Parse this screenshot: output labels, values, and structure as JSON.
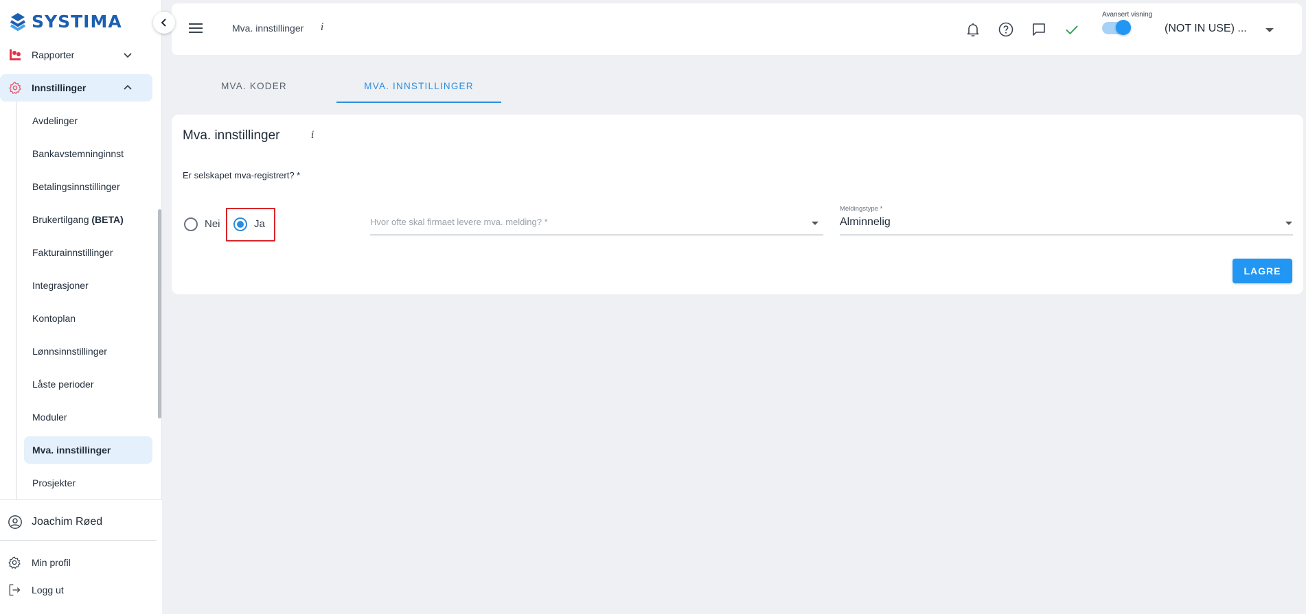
{
  "app": {
    "logo_text": "SYSTIMA",
    "brand_color": "#1d5fb0",
    "accent_color": "#2a8ee0"
  },
  "sidebar": {
    "items": [
      {
        "label": "Rapporter",
        "icon": "chart-icon",
        "expanded": false
      },
      {
        "label": "Innstillinger",
        "icon": "settings-icon",
        "expanded": true
      }
    ],
    "sub_items": [
      {
        "label": "Avdelinger"
      },
      {
        "label": "Bankavstemninginnst"
      },
      {
        "label": "Betalingsinnstillinger"
      },
      {
        "label": "Brukertilgang",
        "suffix": "(BETA)"
      },
      {
        "label": "Fakturainnstillinger"
      },
      {
        "label": "Integrasjoner"
      },
      {
        "label": "Kontoplan"
      },
      {
        "label": "Lønnsinnstillinger"
      },
      {
        "label": "Låste perioder"
      },
      {
        "label": "Moduler"
      },
      {
        "label": "Mva. innstillinger",
        "active": true
      },
      {
        "label": "Prosjekter"
      }
    ],
    "user_name": "Joachim Røed",
    "profile_label": "Min profil",
    "logout_label": "Logg ut"
  },
  "topbar": {
    "breadcrumb": "Mva. innstillinger",
    "info_glyph": "i",
    "advanced_label": "Avansert visning",
    "advanced_on": true,
    "company": "(NOT IN USE) ..."
  },
  "tabs": [
    {
      "label": "MVA. KODER",
      "active": false
    },
    {
      "label": "MVA. INNSTILLINGER",
      "active": true
    }
  ],
  "card": {
    "title": "Mva. innstillinger",
    "info_glyph": "i",
    "question": "Er selskapet mva-registrert? *",
    "radio_nei": "Nei",
    "radio_ja": "Ja",
    "selected": "Ja",
    "frequency_placeholder": "Hvor ofte skal firmaet levere mva. melding? *",
    "meldingstype_label": "Meldingstype *",
    "meldingstype_value": "Alminnelig",
    "save_label": "LAGRE"
  }
}
